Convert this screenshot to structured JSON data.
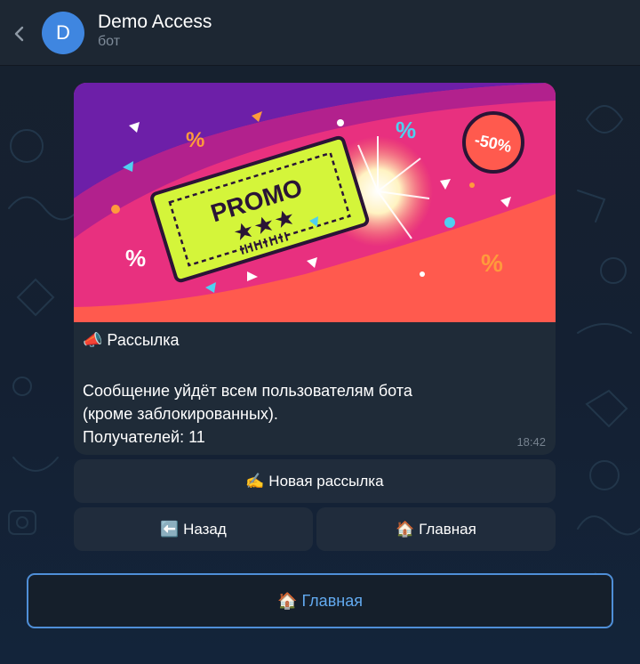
{
  "header": {
    "back_icon": "chevron-left-icon",
    "avatar_letter": "D",
    "avatar_color": "#3f86e0",
    "title": "Demo Access",
    "subtitle": "бот"
  },
  "message": {
    "image": {
      "ticket_text": "PROMO",
      "badge_text": "-50%",
      "colors": {
        "pink": "#e8307f",
        "purple": "#6d1fa8",
        "coral": "#ff5a4e",
        "lime": "#d4f53a"
      }
    },
    "heading": "📣 Рассылка",
    "body_lines": [
      "Сообщение уйдёт всем пользователям бота",
      "(кроме заблокированных).",
      "Получателей: 11"
    ],
    "time": "18:42"
  },
  "inline_keyboard": {
    "new_broadcast": "✍️ Новая рассылка",
    "back": "⬅️ Назад",
    "home": "🏠 Главная"
  },
  "reply_keyboard": {
    "home": "🏠 Главная",
    "accent_color": "#62aaf0"
  }
}
